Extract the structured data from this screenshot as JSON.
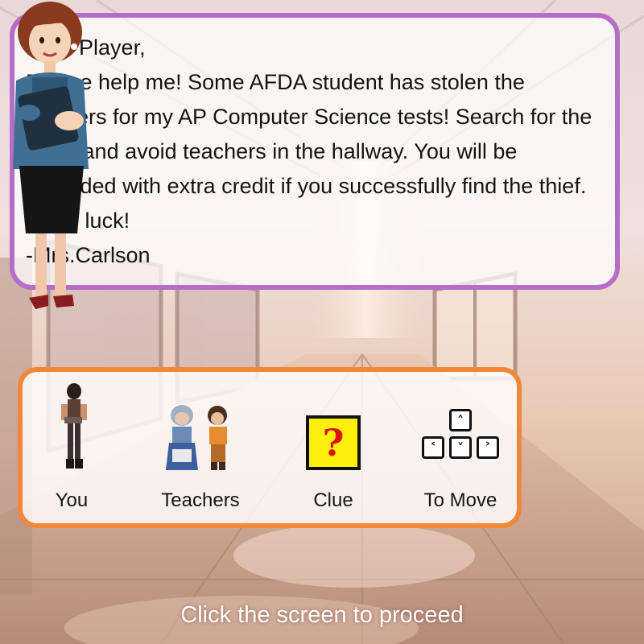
{
  "letter": {
    "lines": [
      "Dear Player,",
      "Please help me! Some AFDA student has stolen the answers for my AP Computer Science tests! Search for the clues and avoid teachers in the hallway. You will be rewarded with extra credit if you successfully find the thief. Good luck!",
      "-Mrs.Carlson"
    ]
  },
  "legend": {
    "you_label": "You",
    "teachers_label": "Teachers",
    "clue_label": "Clue",
    "move_label": "To Move",
    "clue_icon": "question-block-icon",
    "keys": {
      "up": "˄",
      "left": "˂",
      "down": "˅",
      "right": "˃"
    }
  },
  "footer": {
    "proceed_text": "Click the screen to proceed"
  },
  "colors": {
    "letter_border": "#b46ec8",
    "legend_border": "#f0883a",
    "clue_fill": "#ffef0c"
  }
}
